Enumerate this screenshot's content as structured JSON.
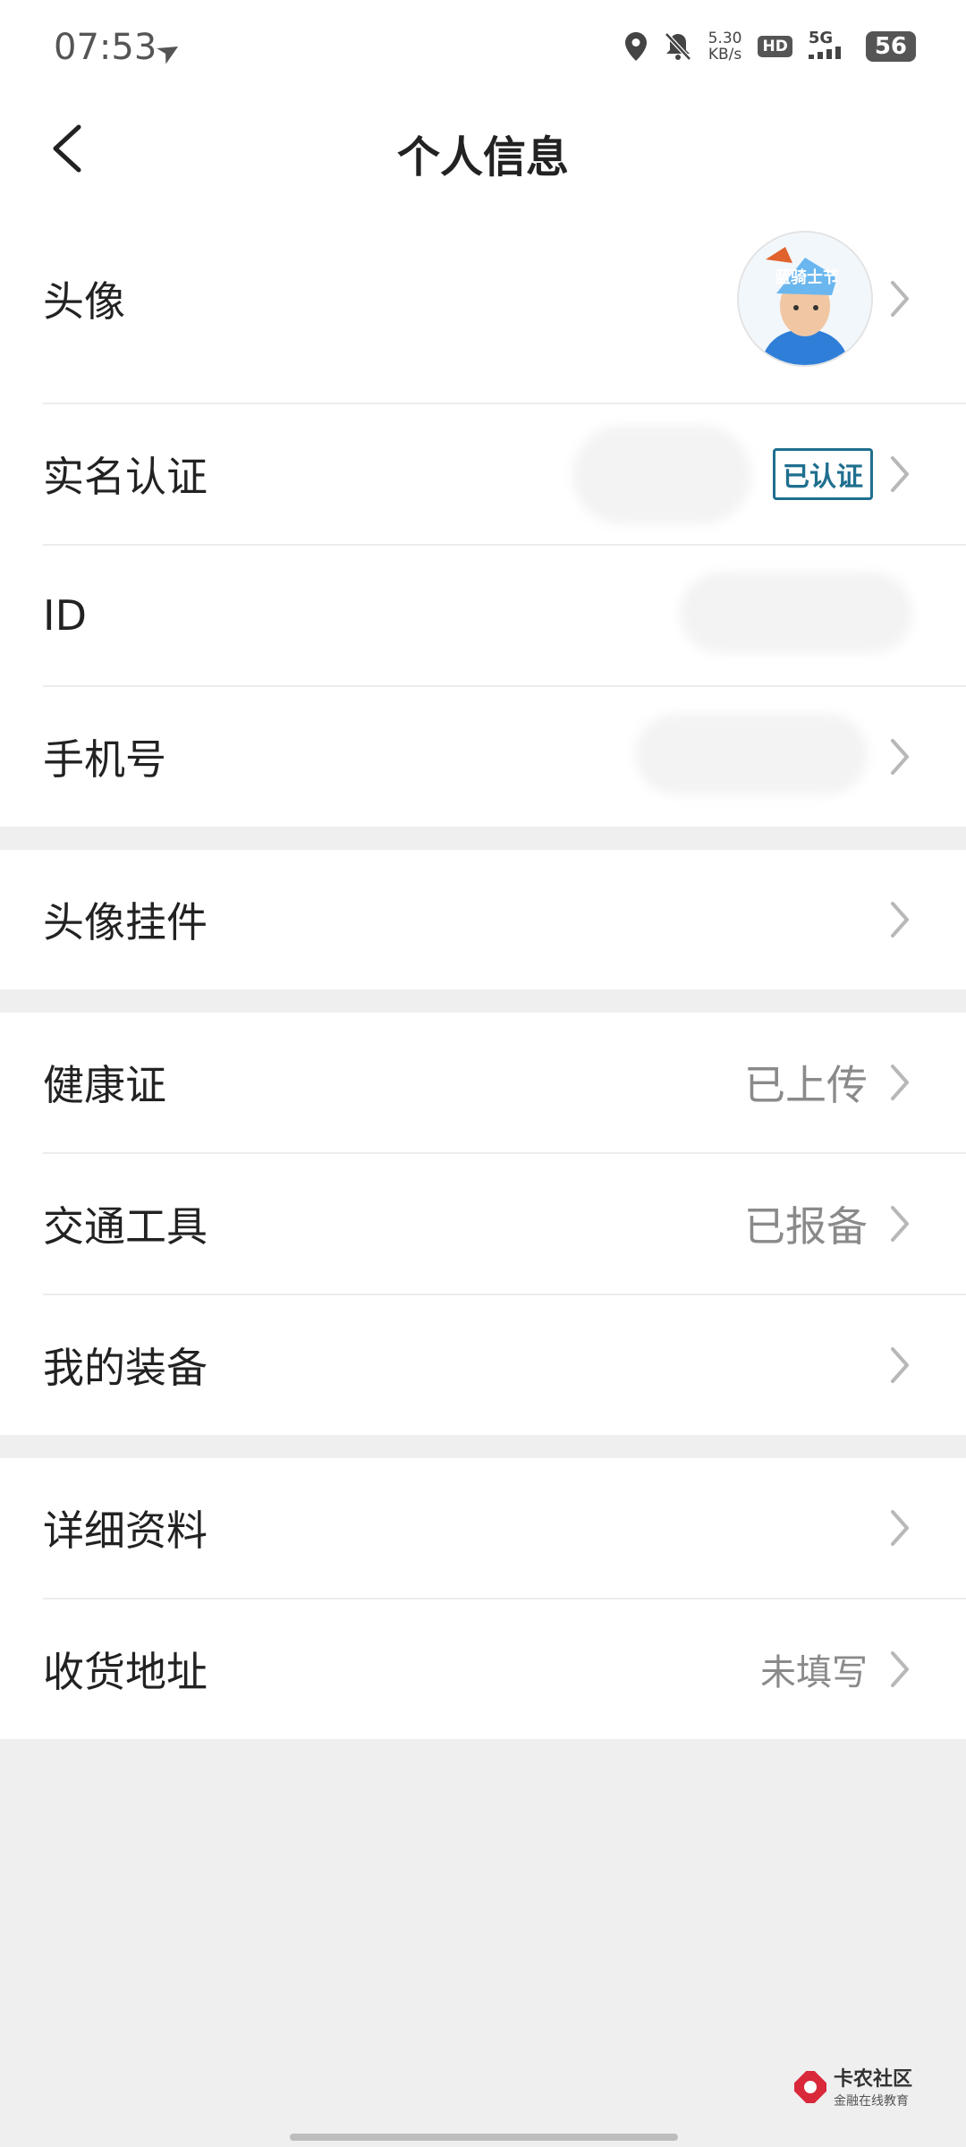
{
  "status_bar": {
    "time": "07:53",
    "net_speed_value": "5.30",
    "net_speed_unit": "KB/s",
    "hd": "HD",
    "signal": "5G",
    "battery": "56"
  },
  "nav": {
    "title": "个人信息"
  },
  "groups": [
    [
      {
        "label": "头像"
      },
      {
        "label": "实名认证",
        "badge": "已认证"
      },
      {
        "label": "ID"
      },
      {
        "label": "手机号"
      }
    ],
    [
      {
        "label": "头像挂件"
      }
    ],
    [
      {
        "label": "健康证",
        "value": "已上传"
      },
      {
        "label": "交通工具",
        "value": "已报备"
      },
      {
        "label": "我的装备"
      }
    ],
    [
      {
        "label": "详细资料"
      },
      {
        "label": "收货地址",
        "value": "未填写"
      }
    ]
  ],
  "avatar": {
    "hat_text": "蓝骑士节"
  },
  "watermark": {
    "title": "卡农社区",
    "subtitle": "金融在线教育"
  },
  "colors": {
    "background": "#efefef",
    "badge": "#1f6f8f",
    "watermark_red": "#d9283a"
  }
}
